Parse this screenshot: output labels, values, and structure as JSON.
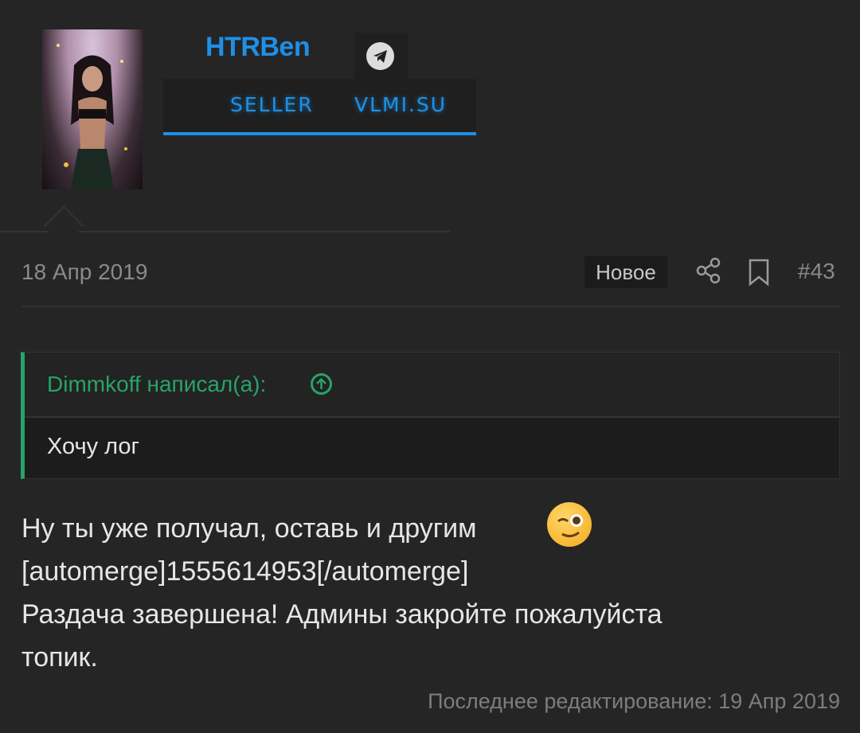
{
  "user": {
    "name": "HTRBen",
    "banner_left": "SELLER",
    "banner_right": "VLMI.SU",
    "accent_color": "#1e90e6",
    "telegram_icon": "telegram-icon"
  },
  "post": {
    "date": "18 Апр 2019",
    "new_badge": "Новое",
    "number": "#43",
    "quote": {
      "author": "Dimmkoff написал(а):",
      "text": "Хочу лог",
      "accent_color": "#27a36b"
    },
    "lines": [
      "Ну ты уже получал, оставь и другим",
      "[automerge]1555614953[/automerge]",
      "Раздача завершена! Админы закройте пожалуйста",
      "топик."
    ],
    "emoji": "wink-emoji",
    "last_edited": "Последнее редактирование: 19 Апр 2019"
  }
}
